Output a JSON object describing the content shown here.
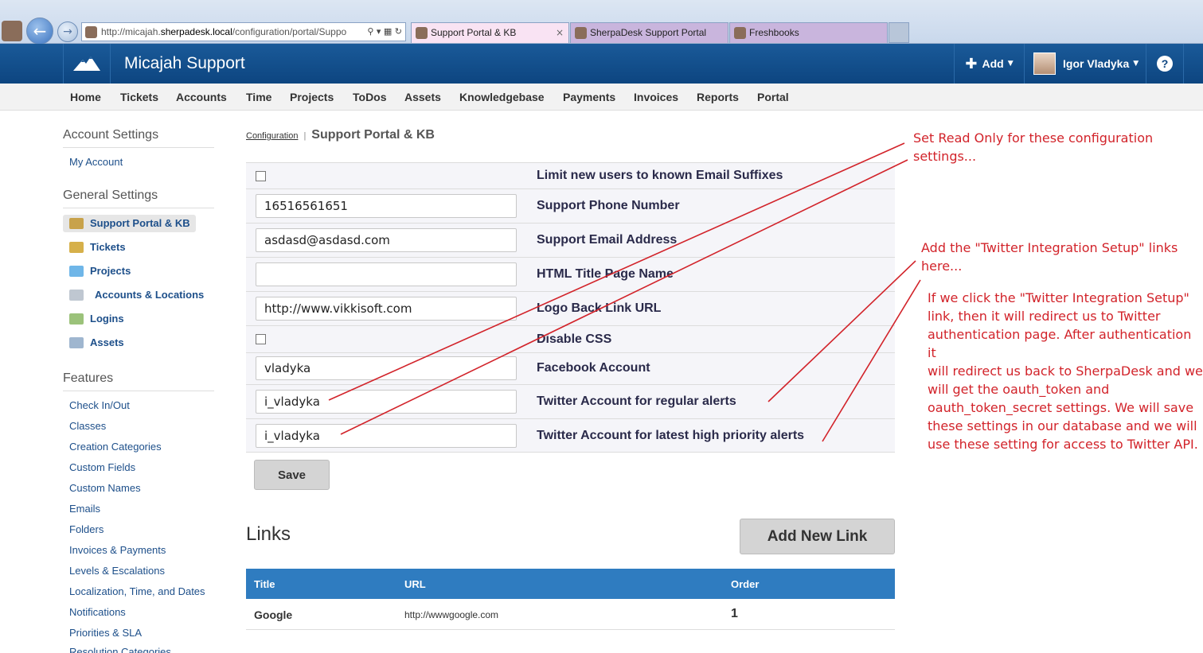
{
  "browser": {
    "address_prefix": "http://micajah.",
    "address_host": "sherpadesk.local",
    "address_rest": "/configuration/portal/Suppo",
    "tabs": [
      {
        "label": "Support Portal & KB",
        "close": "×"
      },
      {
        "label": "SherpaDesk Support Portal"
      },
      {
        "label": "Freshbooks"
      }
    ]
  },
  "header": {
    "title": "Micajah Support",
    "add_label": "Add",
    "user_name": "Igor Vladyka",
    "help": "?"
  },
  "nav": [
    "Home",
    "Tickets",
    "Accounts",
    "Time",
    "Projects",
    "ToDos",
    "Assets",
    "Knowledgebase",
    "Payments",
    "Invoices",
    "Reports",
    "Portal"
  ],
  "sidebar": {
    "account_heading": "Account Settings",
    "my_account": "My Account",
    "general_heading": "General Settings",
    "general_items": [
      "Support Portal & KB",
      "Tickets",
      "Projects",
      "Accounts & Locations",
      "Logins",
      "Assets"
    ],
    "features_heading": "Features",
    "features": [
      "Check In/Out",
      "Classes",
      "Creation Categories",
      "Custom Fields",
      "Custom Names",
      "Emails",
      "Folders",
      "Invoices & Payments",
      "Levels & Escalations",
      "Localization, Time, and Dates",
      "Notifications",
      "Priorities & SLA",
      "Resolution Categories"
    ]
  },
  "breadcrumb": {
    "link": "Configuration",
    "sep": "|",
    "current": "Support Portal & KB"
  },
  "settings": [
    {
      "type": "checkbox",
      "label": "Limit new users to known Email Suffixes",
      "checked": false
    },
    {
      "type": "text",
      "label": "Support Phone Number",
      "value": "16516561651"
    },
    {
      "type": "text",
      "label": "Support Email Address",
      "value": "asdasd@asdasd.com"
    },
    {
      "type": "text",
      "label": "HTML Title Page Name",
      "value": ""
    },
    {
      "type": "text",
      "label": "Logo Back Link URL",
      "value": "http://www.vikkisoft.com"
    },
    {
      "type": "checkbox",
      "label": "Disable CSS",
      "checked": false
    },
    {
      "type": "text",
      "label": "Facebook Account",
      "value": "vladyka"
    },
    {
      "type": "text",
      "label": "Twitter Account for regular alerts",
      "value": "i_vladyka"
    },
    {
      "type": "text",
      "label": "Twitter Account for latest high priority alerts",
      "value": "i_vladyka"
    }
  ],
  "save_label": "Save",
  "links": {
    "title": "Links",
    "add_label": "Add New Link",
    "columns": [
      "Title",
      "URL",
      "Order"
    ],
    "rows": [
      {
        "title": "Google",
        "url": "http://wwwgoogle.com",
        "order": "1"
      }
    ]
  },
  "annotations": {
    "read_only": [
      "Set Read Only for these configuration",
      "settings..."
    ],
    "add_links": [
      "Add the \"Twitter Integration Setup\" links",
      "here..."
    ],
    "explain": [
      "If we click the \"Twitter Integration Setup\"",
      "link, then it will redirect us to Twitter",
      "authentication page. After authentication it",
      "will redirect us back to SherpaDesk and we",
      "will get the oauth_token and",
      "oauth_token_secret settings. We will save",
      "these settings in our database and we will",
      "use these setting for access to Twitter API."
    ]
  },
  "colors": {
    "header_blue": "#0d4580",
    "table_blue": "#2f7cc0",
    "annotation_red": "#d2232a"
  }
}
